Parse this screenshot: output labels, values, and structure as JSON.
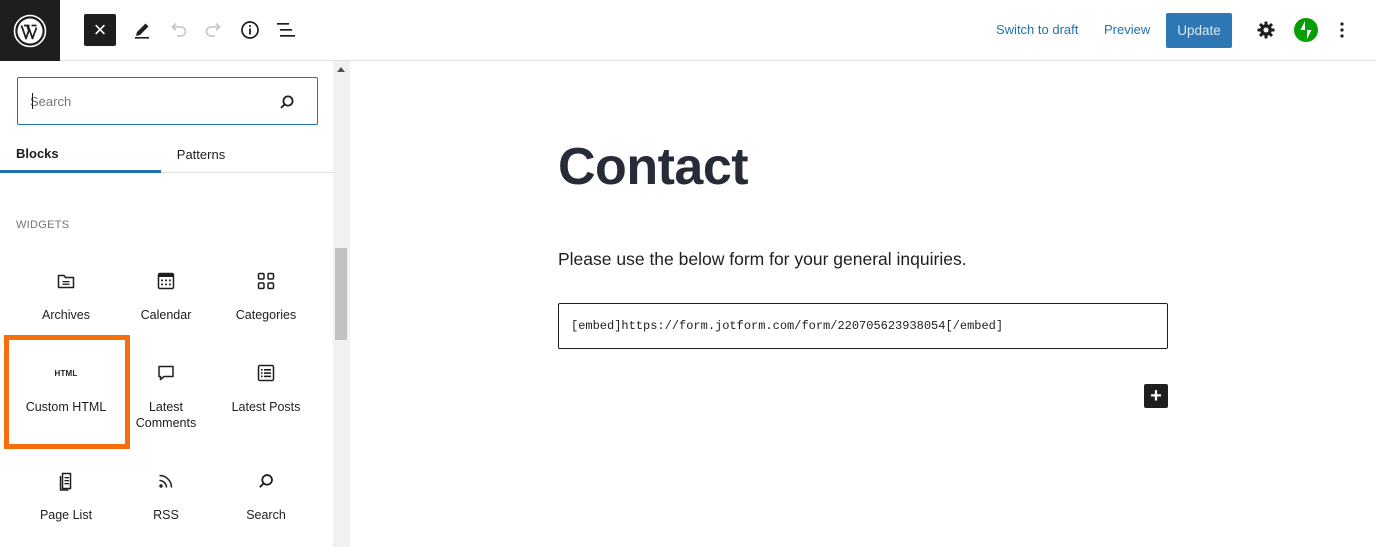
{
  "topbar": {
    "close_symbol": "×",
    "switch_to_draft": "Switch to draft",
    "preview": "Preview",
    "update": "Update",
    "icons": [
      "wordpress-logo",
      "close-icon",
      "pencil-icon",
      "undo-icon",
      "redo-icon",
      "info-icon",
      "list-view-icon",
      "gear-icon",
      "jetpack-icon",
      "more-vertical-icon"
    ]
  },
  "sidebar": {
    "search": {
      "placeholder": "Search",
      "value": ""
    },
    "tabs": [
      {
        "label": "Blocks",
        "active": true
      },
      {
        "label": "Patterns",
        "active": false
      }
    ],
    "category": "WIDGETS",
    "blocks": [
      {
        "label": "Archives",
        "icon": "archive-icon"
      },
      {
        "label": "Calendar",
        "icon": "calendar-icon"
      },
      {
        "label": "Categories",
        "icon": "categories-icon"
      },
      {
        "label": "Custom HTML",
        "icon": "html-icon",
        "icon_text": "HTML",
        "highlighted": true
      },
      {
        "label": "Latest Comments",
        "icon": "comment-icon"
      },
      {
        "label": "Latest Posts",
        "icon": "latest-posts-icon"
      },
      {
        "label": "Page List",
        "icon": "page-list-icon"
      },
      {
        "label": "RSS",
        "icon": "rss-icon"
      },
      {
        "label": "Search",
        "icon": "search-icon"
      }
    ]
  },
  "editor": {
    "title": "Contact",
    "paragraph": "Please use the below form for your general inquiries.",
    "shortcode": "[embed]https://form.jotform.com/form/220705623938054[/embed]",
    "add_block_symbol": "+"
  },
  "colors": {
    "accent": "#2271b1",
    "dark": "#1e1e1e",
    "highlight": "#f56e0b",
    "jetpack": "#069e08",
    "title": "#262b37"
  }
}
